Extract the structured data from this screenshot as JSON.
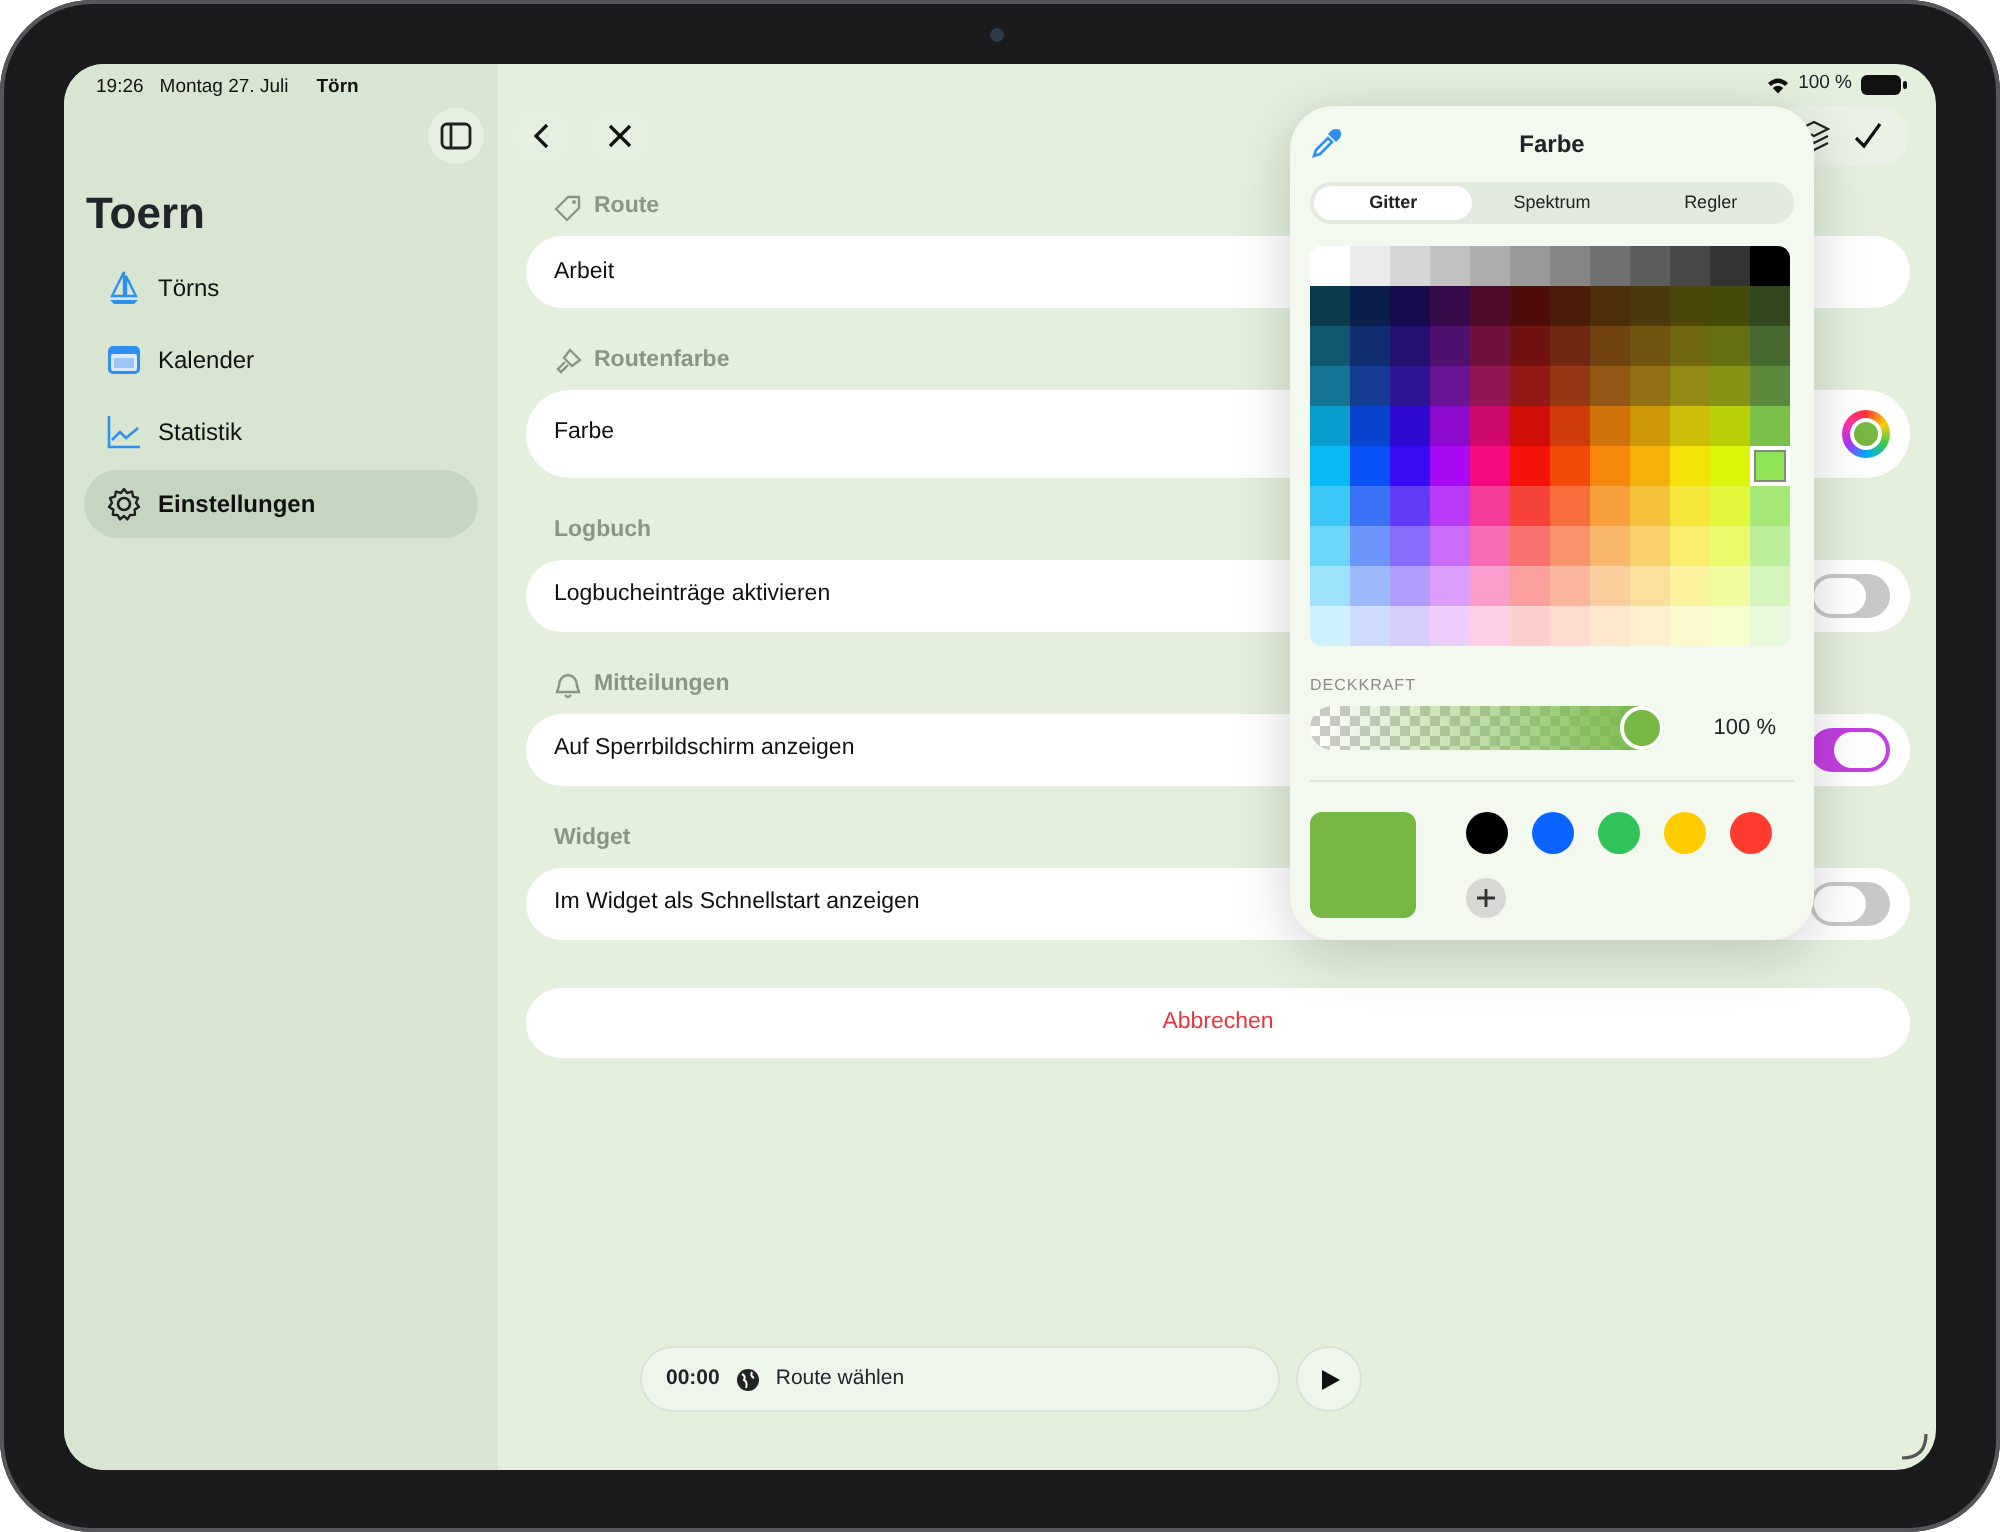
{
  "status_bar": {
    "time": "19:26",
    "date": "Montag 27. Juli",
    "app": "Törn",
    "battery_text": "100 %"
  },
  "sidebar": {
    "title": "Toern",
    "items": [
      {
        "label": "Törns",
        "selected": false
      },
      {
        "label": "Kalender",
        "selected": false
      },
      {
        "label": "Statistik",
        "selected": false
      },
      {
        "label": "Einstellungen",
        "selected": true
      }
    ]
  },
  "form": {
    "sections": [
      {
        "header": "Route",
        "rows": [
          {
            "kind": "text_field",
            "value": "Arbeit"
          }
        ]
      },
      {
        "header": "Routenfarbe",
        "rows": [
          {
            "kind": "color",
            "label": "Farbe",
            "color": "#76b843"
          }
        ]
      },
      {
        "header": "Logbuch",
        "rows": [
          {
            "kind": "toggle",
            "label": "Logbucheinträge aktivieren",
            "on": false
          }
        ]
      },
      {
        "header": "Mitteilungen",
        "rows": [
          {
            "kind": "toggle",
            "label": "Auf Sperrbildschirm anzeigen",
            "on": true
          }
        ]
      },
      {
        "header": "Widget",
        "rows": [
          {
            "kind": "toggle",
            "label": "Im Widget als Schnellstart anzeigen",
            "on": false
          }
        ]
      }
    ]
  },
  "cancel_button": "Abbrechen",
  "player": {
    "time": "00:00",
    "label": "Route wählen"
  },
  "color_popover": {
    "title": "Farbe",
    "tabs": [
      {
        "label": "Gitter",
        "selected": true
      },
      {
        "label": "Spektrum",
        "selected": false
      },
      {
        "label": "Regler",
        "selected": false
      }
    ],
    "grid_rows": [
      {
        "selected": [
          false,
          false,
          false,
          false,
          false,
          false,
          false,
          false,
          false,
          false,
          false,
          false
        ]
      },
      {
        "selected": [
          false,
          false,
          false,
          false,
          false,
          false,
          false,
          false,
          false,
          false,
          false,
          false
        ]
      },
      {
        "selected": [
          false,
          false,
          false,
          false,
          false,
          false,
          false,
          false,
          false,
          false,
          false,
          false
        ]
      },
      {
        "selected": [
          false,
          false,
          false,
          false,
          false,
          false,
          false,
          false,
          false,
          false,
          false,
          false
        ]
      },
      {
        "selected": [
          false,
          false,
          false,
          false,
          false,
          false,
          false,
          false,
          false,
          false,
          false,
          false
        ]
      },
      {
        "selected": [
          false,
          false,
          false,
          false,
          false,
          false,
          false,
          false,
          false,
          false,
          false,
          true
        ]
      },
      {
        "selected": [
          false,
          false,
          false,
          false,
          false,
          false,
          false,
          false,
          false,
          false,
          false,
          false
        ]
      },
      {
        "selected": [
          false,
          false,
          false,
          false,
          false,
          false,
          false,
          false,
          false,
          false,
          false,
          false
        ]
      },
      {
        "selected": [
          false,
          false,
          false,
          false,
          false,
          false,
          false,
          false,
          false,
          false,
          false,
          false
        ]
      },
      {
        "selected": [
          false,
          false,
          false,
          false,
          false,
          false,
          false,
          false,
          false,
          false,
          false,
          false
        ]
      }
    ],
    "opacity": {
      "label": "DECKKRAFT",
      "level": 1,
      "reading": "100 %"
    },
    "recent_colors": [
      {
        "color": "#000000"
      },
      {
        "color": "#0a64ff"
      },
      {
        "color": "#30c35a"
      },
      {
        "color": "#ffcc00"
      },
      {
        "color": "#ff3b30"
      }
    ]
  }
}
